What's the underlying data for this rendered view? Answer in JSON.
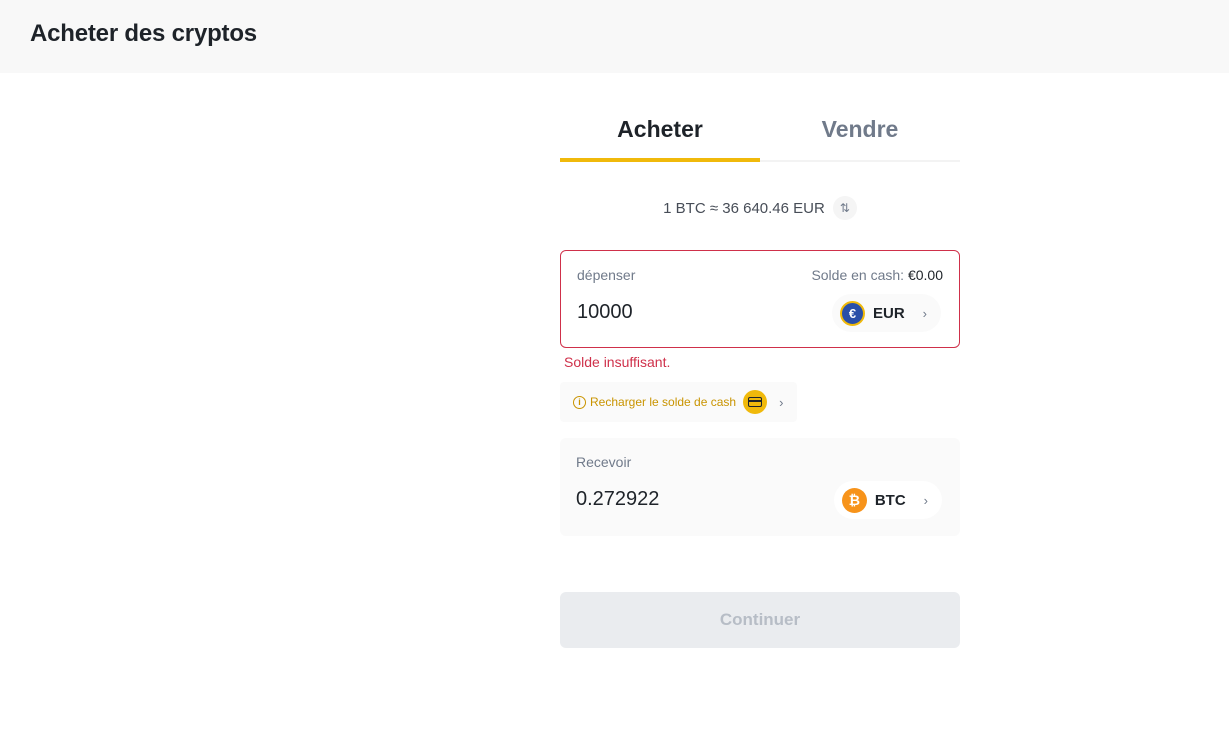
{
  "header": {
    "title": "Acheter des cryptos"
  },
  "tabs": [
    {
      "label": "Acheter",
      "active": true
    },
    {
      "label": "Vendre",
      "active": false
    }
  ],
  "rate": {
    "text": "1 BTC ≈ 36 640.46 EUR",
    "swap_icon": "swap-vertical-icon"
  },
  "spend": {
    "label": "dépenser",
    "balance_label": "Solde en cash:",
    "balance_value": "€0.00",
    "amount": "10000",
    "currency": "EUR",
    "currency_symbol": "€",
    "error": "Solde insuffisant."
  },
  "recharge": {
    "label": "Recharger le solde de cash",
    "info_icon": "i",
    "card_icon": "card-icon"
  },
  "receive": {
    "label": "Recevoir",
    "amount": "0.272922",
    "currency": "BTC",
    "currency_symbol": "₿"
  },
  "continue_button": {
    "label": "Continuer",
    "enabled": false
  },
  "colors": {
    "accent": "#f0b90b",
    "error": "#cf304a",
    "disabled_bg": "#eaecef",
    "disabled_text": "#b7bdc6"
  }
}
